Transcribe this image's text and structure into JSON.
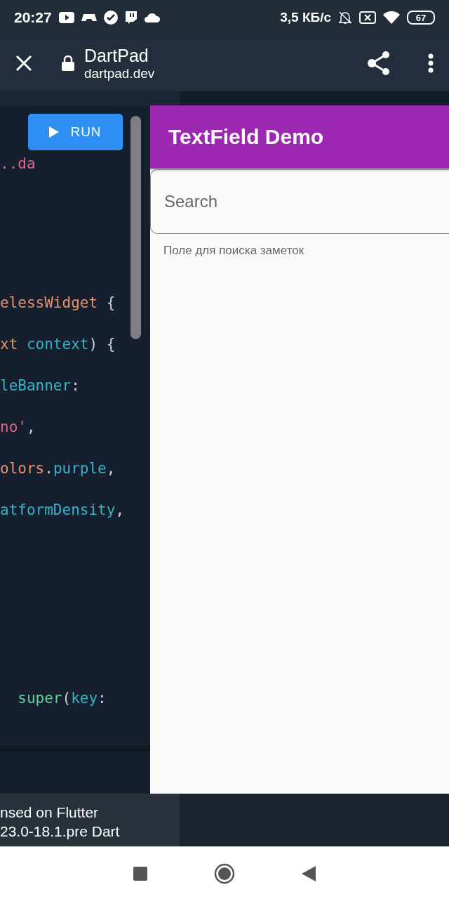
{
  "status_bar": {
    "time": "20:27",
    "speed": "3,5 КБ/с",
    "battery": "67"
  },
  "browser": {
    "title": "DartPad",
    "url": "dartpad.dev"
  },
  "editor": {
    "run_button": "RUN",
    "blocks": [
      [
        [
          {
            "t": "..da",
            "kind": "string"
          }
        ]
      ],
      [
        [
          {
            "t": "elessWidget",
            "kind": "type"
          },
          {
            "t": " {",
            "kind": "punct"
          }
        ],
        [
          {
            "t": "xt",
            "kind": "type"
          },
          {
            "t": " context",
            "kind": "ident"
          },
          {
            "t": ") {",
            "kind": "punct"
          }
        ],
        [
          {
            "t": "leBanner",
            "kind": "ident"
          },
          {
            "t": ":",
            "kind": "punct"
          }
        ],
        [
          {
            "t": "no'",
            "kind": "string"
          },
          {
            "t": ",",
            "kind": "punct"
          }
        ],
        [
          {
            "t": "olors",
            "kind": "type"
          },
          {
            "t": ".",
            "kind": "punct"
          },
          {
            "t": "purple",
            "kind": "ident"
          },
          {
            "t": ",",
            "kind": "punct"
          }
        ],
        [
          {
            "t": "atformDensity",
            "kind": "ident"
          },
          {
            "t": ",",
            "kind": "punct"
          }
        ]
      ],
      [
        [
          {
            "t": "  super",
            "kind": "keyword"
          },
          {
            "t": "(",
            "kind": "punct"
          },
          {
            "t": "key",
            "kind": "ident"
          },
          {
            "t": ":",
            "kind": "punct"
          }
        ]
      ]
    ]
  },
  "preview": {
    "app_bar_title": "TextField Demo",
    "search": {
      "placeholder": "Search"
    },
    "helper_text": "Поле для поиска заметок"
  },
  "footer": {
    "lines": [
      "nsed on Flutter",
      "23.0-18.1.pre Dart"
    ]
  }
}
